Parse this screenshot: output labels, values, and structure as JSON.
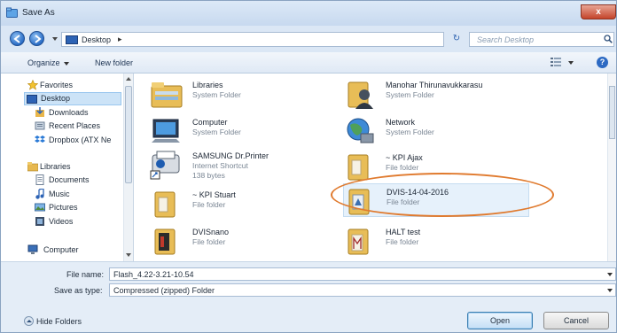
{
  "window": {
    "title": "Save As",
    "close_glyph": "x"
  },
  "nav": {
    "address_segment": "Desktop",
    "address_arrow": "▸",
    "refresh_glyph": "↻",
    "search_placeholder": "Search Desktop"
  },
  "toolbar": {
    "organize_label": "Organize",
    "new_folder_label": "New folder",
    "help_glyph": "?"
  },
  "sidebar": {
    "items": [
      {
        "label": "Favorites",
        "icon": "star-icon"
      },
      {
        "label": "Desktop",
        "icon": "desktop-icon"
      },
      {
        "label": "Downloads",
        "icon": "downloads-icon"
      },
      {
        "label": "Recent Places",
        "icon": "recent-places-icon"
      },
      {
        "label": "Dropbox (ATX Ne",
        "icon": "dropbox-icon"
      },
      {
        "label": "Libraries",
        "icon": "libraries-icon"
      },
      {
        "label": "Documents",
        "icon": "documents-icon"
      },
      {
        "label": "Music",
        "icon": "music-icon"
      },
      {
        "label": "Pictures",
        "icon": "pictures-icon"
      },
      {
        "label": "Videos",
        "icon": "videos-icon"
      },
      {
        "label": "Computer",
        "icon": "computer-icon"
      }
    ]
  },
  "files": [
    {
      "name": "Libraries",
      "type": "System Folder",
      "icon": "libraries-folder-icon"
    },
    {
      "name": "Manohar Thirunavukkarasu",
      "type": "System Folder",
      "icon": "user-folder-icon"
    },
    {
      "name": "Computer",
      "type": "System Folder",
      "icon": "computer-icon"
    },
    {
      "name": "Network",
      "type": "System Folder",
      "icon": "network-icon"
    },
    {
      "name": "SAMSUNG Dr.Printer",
      "type": "Internet Shortcut",
      "size": "138 bytes",
      "icon": "shortcut-icon"
    },
    {
      "name": "~ KPI Ajax",
      "type": "File folder",
      "icon": "folder-icon"
    },
    {
      "name": "~ KPI Stuart",
      "type": "File folder",
      "icon": "folder-icon"
    },
    {
      "name": "DVIS-14-04-2016",
      "type": "File folder",
      "icon": "folder-icon"
    },
    {
      "name": "DVISnano",
      "type": "File folder",
      "icon": "folder-icon"
    },
    {
      "name": "HALT test",
      "type": "File folder",
      "icon": "folder-icon"
    }
  ],
  "form": {
    "file_name_label": "File name:",
    "file_name_value": "Flash_4.22-3.21-10.54",
    "save_as_type_label": "Save as type:",
    "save_as_type_value": "Compressed (zipped) Folder"
  },
  "footer": {
    "hide_folders_label": "Hide Folders",
    "open_label": "Open",
    "cancel_label": "Cancel"
  },
  "colors": {
    "highlight_ellipse": "#e07a2e",
    "selection": "#cce3f7",
    "window_bg": "#e4edf7"
  }
}
